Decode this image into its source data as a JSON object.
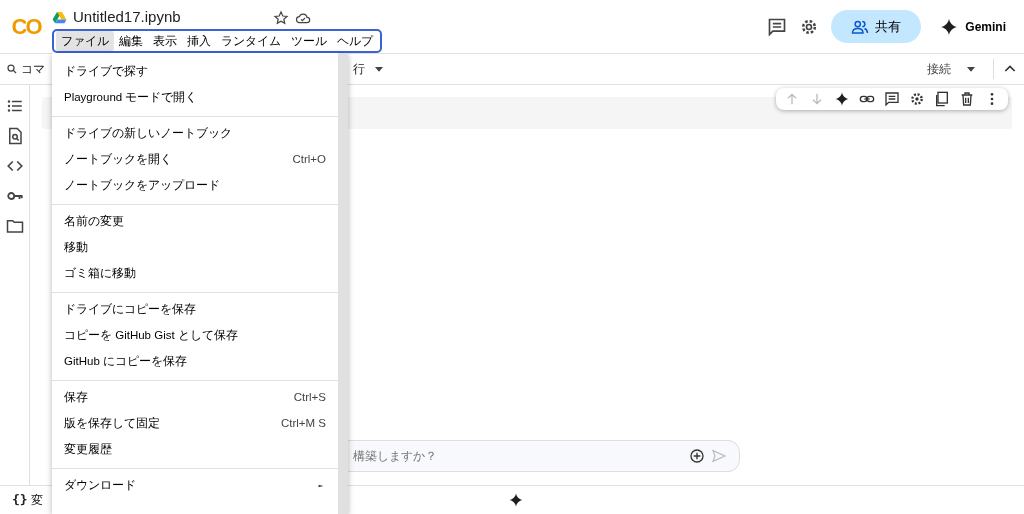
{
  "header": {
    "logo": "CO",
    "title": "Untitled17.ipynb",
    "share_button": "共有",
    "gemini_button": "Gemini",
    "menus": [
      {
        "label": "ファイル",
        "selected": true
      },
      {
        "label": "編集",
        "selected": false
      },
      {
        "label": "表示",
        "selected": false
      },
      {
        "label": "挿入",
        "selected": false
      },
      {
        "label": "ランタイム",
        "selected": false
      },
      {
        "label": "ツール",
        "selected": false
      },
      {
        "label": "ヘルプ",
        "selected": false
      }
    ]
  },
  "toolbar": {
    "search_text": "コマ",
    "run_text": "行",
    "connect_button": "接続"
  },
  "chat": {
    "placeholder": "構築しますか？"
  },
  "status_bar": {
    "braces": "{}",
    "variables": "変"
  },
  "file_menu": {
    "groups": [
      [
        {
          "label": "ドライブで探す"
        },
        {
          "label": "Playground モードで開く"
        }
      ],
      [
        {
          "label": "ドライブの新しいノートブック"
        },
        {
          "label": "ノートブックを開く",
          "shortcut": "Ctrl+O"
        },
        {
          "label": "ノートブックをアップロード"
        }
      ],
      [
        {
          "label": "名前の変更"
        },
        {
          "label": "移動"
        },
        {
          "label": "ゴミ箱に移動"
        }
      ],
      [
        {
          "label": "ドライブにコピーを保存"
        },
        {
          "label": "コピーを GitHub Gist として保存"
        },
        {
          "label": "GitHub にコピーを保存"
        }
      ],
      [
        {
          "label": "保存",
          "shortcut": "Ctrl+S"
        },
        {
          "label": "版を保存して固定",
          "shortcut": "Ctrl+M S"
        },
        {
          "label": "変更履歴"
        }
      ],
      [
        {
          "label": "ダウンロード",
          "submenu": true
        }
      ]
    ]
  }
}
